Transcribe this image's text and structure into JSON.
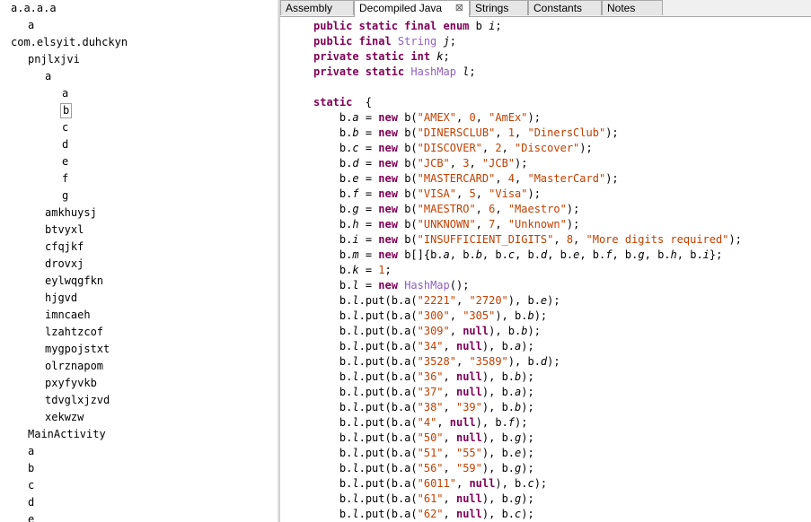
{
  "tree": [
    {
      "label": "a.a.a.a",
      "indent": 0
    },
    {
      "label": "a",
      "indent": 1
    },
    {
      "label": "com.elsyit.duhckyn",
      "indent": 0
    },
    {
      "label": "pnjlxjvi",
      "indent": 1
    },
    {
      "label": "a",
      "indent": 2
    },
    {
      "label": "a",
      "indent": 3
    },
    {
      "label": "b",
      "indent": 3,
      "selected": true
    },
    {
      "label": "c",
      "indent": 3
    },
    {
      "label": "d",
      "indent": 3
    },
    {
      "label": "e",
      "indent": 3
    },
    {
      "label": "f",
      "indent": 3
    },
    {
      "label": "g",
      "indent": 3
    },
    {
      "label": "amkhuysj",
      "indent": 2
    },
    {
      "label": "btvyxl",
      "indent": 2
    },
    {
      "label": "cfqjkf",
      "indent": 2
    },
    {
      "label": "drovxj",
      "indent": 2
    },
    {
      "label": "eylwqgfkn",
      "indent": 2
    },
    {
      "label": "hjgvd",
      "indent": 2
    },
    {
      "label": "imncaeh",
      "indent": 2
    },
    {
      "label": "lzahtzcof",
      "indent": 2
    },
    {
      "label": "mygpojstxt",
      "indent": 2
    },
    {
      "label": "olrznapom",
      "indent": 2
    },
    {
      "label": "pxyfyvkb",
      "indent": 2
    },
    {
      "label": "tdvglxjzvd",
      "indent": 2
    },
    {
      "label": "xekwzw",
      "indent": 2
    },
    {
      "label": "MainActivity",
      "indent": 1
    },
    {
      "label": "a",
      "indent": 1
    },
    {
      "label": "b",
      "indent": 1
    },
    {
      "label": "c",
      "indent": 1
    },
    {
      "label": "d",
      "indent": 1
    },
    {
      "label": "e",
      "indent": 1
    }
  ],
  "tabs": [
    {
      "label": "Assembly",
      "active": false
    },
    {
      "label": "Decompiled Java",
      "active": true,
      "close": "⊠"
    },
    {
      "label": "Strings",
      "active": false
    },
    {
      "label": "Constants",
      "active": false
    },
    {
      "label": "Notes",
      "active": false
    }
  ],
  "code": [
    [
      [
        "kw",
        "public static final enum "
      ],
      [
        "nm",
        "b "
      ],
      [
        "fl",
        "i"
      ],
      [
        "nm",
        ";"
      ]
    ],
    [
      [
        "kw",
        "public final "
      ],
      [
        "ty",
        "String "
      ],
      [
        "fl",
        "j"
      ],
      [
        "nm",
        ";"
      ]
    ],
    [
      [
        "kw",
        "private static int "
      ],
      [
        "fl",
        "k"
      ],
      [
        "nm",
        ";"
      ]
    ],
    [
      [
        "kw",
        "private static "
      ],
      [
        "ty",
        "HashMap "
      ],
      [
        "fl",
        "l"
      ],
      [
        "nm",
        ";"
      ]
    ],
    [],
    [
      [
        "kw",
        "static "
      ],
      [
        "nm",
        " {"
      ]
    ],
    [
      [
        "nm",
        "    b."
      ],
      [
        "fl",
        "a"
      ],
      [
        "nm",
        " = "
      ],
      [
        "kw",
        "new "
      ],
      [
        "nm",
        "b("
      ],
      [
        "st",
        "\"AMEX\""
      ],
      [
        "nm",
        ", "
      ],
      [
        "st",
        "0"
      ],
      [
        "nm",
        ", "
      ],
      [
        "st",
        "\"AmEx\""
      ],
      [
        "nm",
        ");"
      ]
    ],
    [
      [
        "nm",
        "    b."
      ],
      [
        "fl",
        "b"
      ],
      [
        "nm",
        " = "
      ],
      [
        "kw",
        "new "
      ],
      [
        "nm",
        "b("
      ],
      [
        "st",
        "\"DINERSCLUB\""
      ],
      [
        "nm",
        ", "
      ],
      [
        "st",
        "1"
      ],
      [
        "nm",
        ", "
      ],
      [
        "st",
        "\"DinersClub\""
      ],
      [
        "nm",
        ");"
      ]
    ],
    [
      [
        "nm",
        "    b."
      ],
      [
        "fl",
        "c"
      ],
      [
        "nm",
        " = "
      ],
      [
        "kw",
        "new "
      ],
      [
        "nm",
        "b("
      ],
      [
        "st",
        "\"DISCOVER\""
      ],
      [
        "nm",
        ", "
      ],
      [
        "st",
        "2"
      ],
      [
        "nm",
        ", "
      ],
      [
        "st",
        "\"Discover\""
      ],
      [
        "nm",
        ");"
      ]
    ],
    [
      [
        "nm",
        "    b."
      ],
      [
        "fl",
        "d"
      ],
      [
        "nm",
        " = "
      ],
      [
        "kw",
        "new "
      ],
      [
        "nm",
        "b("
      ],
      [
        "st",
        "\"JCB\""
      ],
      [
        "nm",
        ", "
      ],
      [
        "st",
        "3"
      ],
      [
        "nm",
        ", "
      ],
      [
        "st",
        "\"JCB\""
      ],
      [
        "nm",
        ");"
      ]
    ],
    [
      [
        "nm",
        "    b."
      ],
      [
        "fl",
        "e"
      ],
      [
        "nm",
        " = "
      ],
      [
        "kw",
        "new "
      ],
      [
        "nm",
        "b("
      ],
      [
        "st",
        "\"MASTERCARD\""
      ],
      [
        "nm",
        ", "
      ],
      [
        "st",
        "4"
      ],
      [
        "nm",
        ", "
      ],
      [
        "st",
        "\"MasterCard\""
      ],
      [
        "nm",
        ");"
      ]
    ],
    [
      [
        "nm",
        "    b."
      ],
      [
        "fl",
        "f"
      ],
      [
        "nm",
        " = "
      ],
      [
        "kw",
        "new "
      ],
      [
        "nm",
        "b("
      ],
      [
        "st",
        "\"VISA\""
      ],
      [
        "nm",
        ", "
      ],
      [
        "st",
        "5"
      ],
      [
        "nm",
        ", "
      ],
      [
        "st",
        "\"Visa\""
      ],
      [
        "nm",
        ");"
      ]
    ],
    [
      [
        "nm",
        "    b."
      ],
      [
        "fl",
        "g"
      ],
      [
        "nm",
        " = "
      ],
      [
        "kw",
        "new "
      ],
      [
        "nm",
        "b("
      ],
      [
        "st",
        "\"MAESTRO\""
      ],
      [
        "nm",
        ", "
      ],
      [
        "st",
        "6"
      ],
      [
        "nm",
        ", "
      ],
      [
        "st",
        "\"Maestro\""
      ],
      [
        "nm",
        ");"
      ]
    ],
    [
      [
        "nm",
        "    b."
      ],
      [
        "fl",
        "h"
      ],
      [
        "nm",
        " = "
      ],
      [
        "kw",
        "new "
      ],
      [
        "nm",
        "b("
      ],
      [
        "st",
        "\"UNKNOWN\""
      ],
      [
        "nm",
        ", "
      ],
      [
        "st",
        "7"
      ],
      [
        "nm",
        ", "
      ],
      [
        "st",
        "\"Unknown\""
      ],
      [
        "nm",
        ");"
      ]
    ],
    [
      [
        "nm",
        "    b."
      ],
      [
        "fl",
        "i"
      ],
      [
        "nm",
        " = "
      ],
      [
        "kw",
        "new "
      ],
      [
        "nm",
        "b("
      ],
      [
        "st",
        "\"INSUFFICIENT_DIGITS\""
      ],
      [
        "nm",
        ", "
      ],
      [
        "st",
        "8"
      ],
      [
        "nm",
        ", "
      ],
      [
        "st",
        "\"More digits required\""
      ],
      [
        "nm",
        ");"
      ]
    ],
    [
      [
        "nm",
        "    b."
      ],
      [
        "fl",
        "m"
      ],
      [
        "nm",
        " = "
      ],
      [
        "kw",
        "new "
      ],
      [
        "nm",
        "b[]{b."
      ],
      [
        "fl",
        "a"
      ],
      [
        "nm",
        ", b."
      ],
      [
        "fl",
        "b"
      ],
      [
        "nm",
        ", b."
      ],
      [
        "fl",
        "c"
      ],
      [
        "nm",
        ", b."
      ],
      [
        "fl",
        "d"
      ],
      [
        "nm",
        ", b."
      ],
      [
        "fl",
        "e"
      ],
      [
        "nm",
        ", b."
      ],
      [
        "fl",
        "f"
      ],
      [
        "nm",
        ", b."
      ],
      [
        "fl",
        "g"
      ],
      [
        "nm",
        ", b."
      ],
      [
        "fl",
        "h"
      ],
      [
        "nm",
        ", b."
      ],
      [
        "fl",
        "i"
      ],
      [
        "nm",
        "};"
      ]
    ],
    [
      [
        "nm",
        "    b."
      ],
      [
        "fl",
        "k"
      ],
      [
        "nm",
        " = "
      ],
      [
        "st",
        "1"
      ],
      [
        "nm",
        ";"
      ]
    ],
    [
      [
        "nm",
        "    b."
      ],
      [
        "fl",
        "l"
      ],
      [
        "nm",
        " = "
      ],
      [
        "kw",
        "new "
      ],
      [
        "ty",
        "HashMap"
      ],
      [
        "nm",
        "();"
      ]
    ],
    [
      [
        "nm",
        "    b."
      ],
      [
        "fl",
        "l"
      ],
      [
        "nm",
        ".put(b.a("
      ],
      [
        "st",
        "\"2221\""
      ],
      [
        "nm",
        ", "
      ],
      [
        "st",
        "\"2720\""
      ],
      [
        "nm",
        "), b."
      ],
      [
        "fl",
        "e"
      ],
      [
        "nm",
        ");"
      ]
    ],
    [
      [
        "nm",
        "    b."
      ],
      [
        "fl",
        "l"
      ],
      [
        "nm",
        ".put(b.a("
      ],
      [
        "st",
        "\"300\""
      ],
      [
        "nm",
        ", "
      ],
      [
        "st",
        "\"305\""
      ],
      [
        "nm",
        "), b."
      ],
      [
        "fl",
        "b"
      ],
      [
        "nm",
        ");"
      ]
    ],
    [
      [
        "nm",
        "    b."
      ],
      [
        "fl",
        "l"
      ],
      [
        "nm",
        ".put(b.a("
      ],
      [
        "st",
        "\"309\""
      ],
      [
        "nm",
        ", "
      ],
      [
        "kw",
        "null"
      ],
      [
        "nm",
        "), b."
      ],
      [
        "fl",
        "b"
      ],
      [
        "nm",
        ");"
      ]
    ],
    [
      [
        "nm",
        "    b."
      ],
      [
        "fl",
        "l"
      ],
      [
        "nm",
        ".put(b.a("
      ],
      [
        "st",
        "\"34\""
      ],
      [
        "nm",
        ", "
      ],
      [
        "kw",
        "null"
      ],
      [
        "nm",
        "), b."
      ],
      [
        "fl",
        "a"
      ],
      [
        "nm",
        ");"
      ]
    ],
    [
      [
        "nm",
        "    b."
      ],
      [
        "fl",
        "l"
      ],
      [
        "nm",
        ".put(b.a("
      ],
      [
        "st",
        "\"3528\""
      ],
      [
        "nm",
        ", "
      ],
      [
        "st",
        "\"3589\""
      ],
      [
        "nm",
        "), b."
      ],
      [
        "fl",
        "d"
      ],
      [
        "nm",
        ");"
      ]
    ],
    [
      [
        "nm",
        "    b."
      ],
      [
        "fl",
        "l"
      ],
      [
        "nm",
        ".put(b.a("
      ],
      [
        "st",
        "\"36\""
      ],
      [
        "nm",
        ", "
      ],
      [
        "kw",
        "null"
      ],
      [
        "nm",
        "), b."
      ],
      [
        "fl",
        "b"
      ],
      [
        "nm",
        ");"
      ]
    ],
    [
      [
        "nm",
        "    b."
      ],
      [
        "fl",
        "l"
      ],
      [
        "nm",
        ".put(b.a("
      ],
      [
        "st",
        "\"37\""
      ],
      [
        "nm",
        ", "
      ],
      [
        "kw",
        "null"
      ],
      [
        "nm",
        "), b."
      ],
      [
        "fl",
        "a"
      ],
      [
        "nm",
        ");"
      ]
    ],
    [
      [
        "nm",
        "    b."
      ],
      [
        "fl",
        "l"
      ],
      [
        "nm",
        ".put(b.a("
      ],
      [
        "st",
        "\"38\""
      ],
      [
        "nm",
        ", "
      ],
      [
        "st",
        "\"39\""
      ],
      [
        "nm",
        "), b."
      ],
      [
        "fl",
        "b"
      ],
      [
        "nm",
        ");"
      ]
    ],
    [
      [
        "nm",
        "    b."
      ],
      [
        "fl",
        "l"
      ],
      [
        "nm",
        ".put(b.a("
      ],
      [
        "st",
        "\"4\""
      ],
      [
        "nm",
        ", "
      ],
      [
        "kw",
        "null"
      ],
      [
        "nm",
        "), b."
      ],
      [
        "fl",
        "f"
      ],
      [
        "nm",
        ");"
      ]
    ],
    [
      [
        "nm",
        "    b."
      ],
      [
        "fl",
        "l"
      ],
      [
        "nm",
        ".put(b.a("
      ],
      [
        "st",
        "\"50\""
      ],
      [
        "nm",
        ", "
      ],
      [
        "kw",
        "null"
      ],
      [
        "nm",
        "), b."
      ],
      [
        "fl",
        "g"
      ],
      [
        "nm",
        ");"
      ]
    ],
    [
      [
        "nm",
        "    b."
      ],
      [
        "fl",
        "l"
      ],
      [
        "nm",
        ".put(b.a("
      ],
      [
        "st",
        "\"51\""
      ],
      [
        "nm",
        ", "
      ],
      [
        "st",
        "\"55\""
      ],
      [
        "nm",
        "), b."
      ],
      [
        "fl",
        "e"
      ],
      [
        "nm",
        ");"
      ]
    ],
    [
      [
        "nm",
        "    b."
      ],
      [
        "fl",
        "l"
      ],
      [
        "nm",
        ".put(b.a("
      ],
      [
        "st",
        "\"56\""
      ],
      [
        "nm",
        ", "
      ],
      [
        "st",
        "\"59\""
      ],
      [
        "nm",
        "), b."
      ],
      [
        "fl",
        "g"
      ],
      [
        "nm",
        ");"
      ]
    ],
    [
      [
        "nm",
        "    b."
      ],
      [
        "fl",
        "l"
      ],
      [
        "nm",
        ".put(b.a("
      ],
      [
        "st",
        "\"6011\""
      ],
      [
        "nm",
        ", "
      ],
      [
        "kw",
        "null"
      ],
      [
        "nm",
        "), b."
      ],
      [
        "fl",
        "c"
      ],
      [
        "nm",
        ");"
      ]
    ],
    [
      [
        "nm",
        "    b."
      ],
      [
        "fl",
        "l"
      ],
      [
        "nm",
        ".put(b.a("
      ],
      [
        "st",
        "\"61\""
      ],
      [
        "nm",
        ", "
      ],
      [
        "kw",
        "null"
      ],
      [
        "nm",
        "), b."
      ],
      [
        "fl",
        "g"
      ],
      [
        "nm",
        ");"
      ]
    ],
    [
      [
        "nm",
        "    b."
      ],
      [
        "fl",
        "l"
      ],
      [
        "nm",
        ".put(b.a("
      ],
      [
        "st",
        "\"62\""
      ],
      [
        "nm",
        ", "
      ],
      [
        "kw",
        "null"
      ],
      [
        "nm",
        "), b."
      ],
      [
        "fl",
        "c"
      ],
      [
        "nm",
        ");"
      ]
    ]
  ]
}
